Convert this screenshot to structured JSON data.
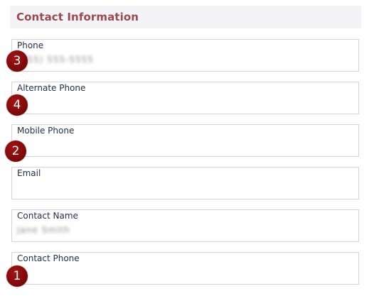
{
  "section": {
    "title": "Contact Information"
  },
  "fields": [
    {
      "label": "Phone",
      "value": "(555) 555-5555"
    },
    {
      "label": "Alternate Phone",
      "value": ""
    },
    {
      "label": "Mobile Phone",
      "value": ""
    },
    {
      "label": "Email",
      "value": ""
    },
    {
      "label": "Contact Name",
      "value": "Jane Smith"
    },
    {
      "label": "Contact Phone",
      "value": ""
    }
  ],
  "badges": [
    "3",
    "4",
    "2",
    "1"
  ],
  "colors": {
    "title": "#9a4a4a",
    "header_bg": "#f4f4f8",
    "label": "#22304a",
    "field_border": "#d4d4d8",
    "badge": "#7a0808"
  }
}
